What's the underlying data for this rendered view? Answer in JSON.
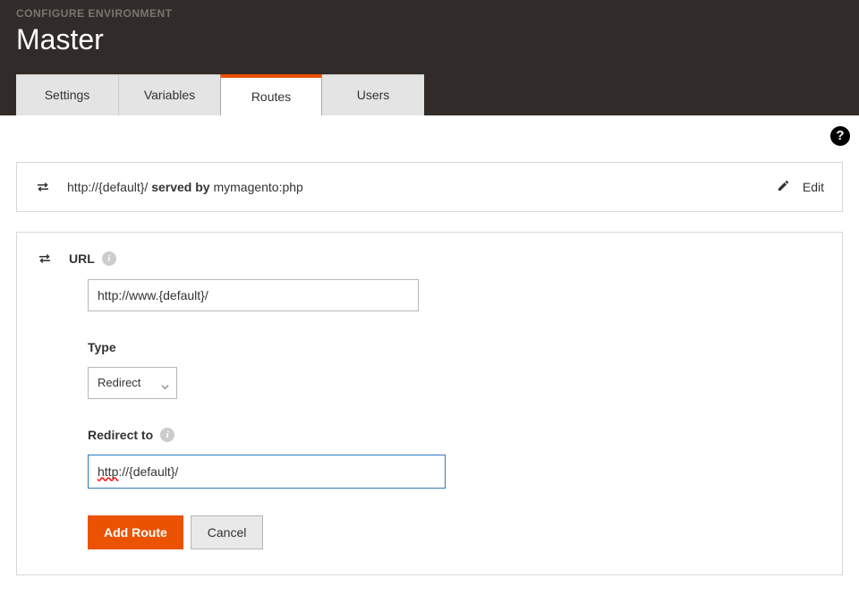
{
  "header": {
    "subtitle": "CONFIGURE ENVIRONMENT",
    "title": "Master"
  },
  "tabs": {
    "items": [
      {
        "label": "Settings"
      },
      {
        "label": "Variables"
      },
      {
        "label": "Routes"
      },
      {
        "label": "Users"
      }
    ]
  },
  "help_icon_glyph": "?",
  "route_row": {
    "url_text": "http://{default}/ ",
    "served_bold": "served by",
    "served_value": " mymagento:php",
    "edit_label": "Edit"
  },
  "form": {
    "url_label": "URL",
    "url_value": "http://www.{default}/",
    "type_label": "Type",
    "type_value": "Redirect",
    "redirect_label": "Redirect to",
    "redirect_value_prefix": "http",
    "redirect_value_rest": "://{default}/",
    "add_route_label": "Add Route",
    "cancel_label": "Cancel",
    "info_glyph": "i"
  }
}
